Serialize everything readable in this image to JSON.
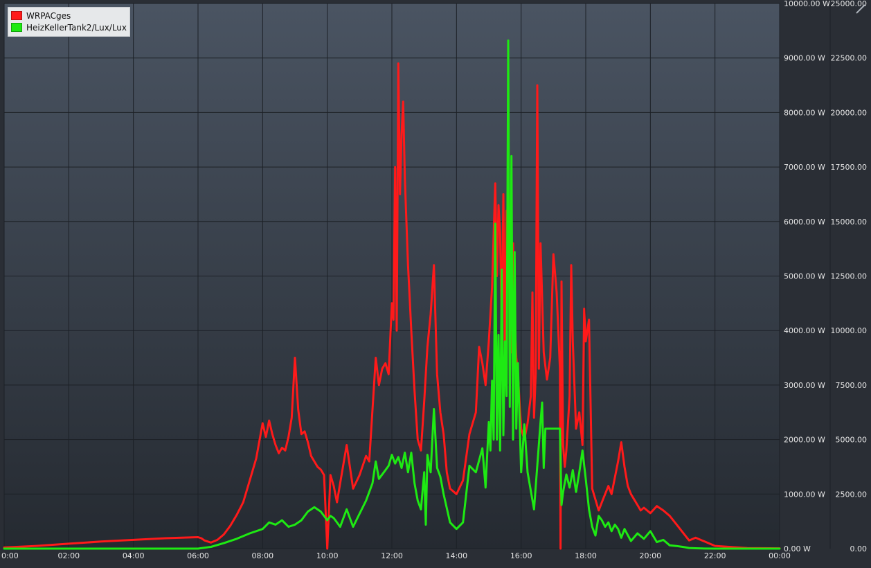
{
  "chart_data": {
    "type": "line",
    "x_axis": {
      "tick_labels": [
        "0:00",
        "02:00",
        "04:00",
        "06:00",
        "08:00",
        "10:00",
        "12:00",
        "14:00",
        "16:00",
        "18:00",
        "20:00",
        "22:00",
        "00:00"
      ],
      "range_hours": [
        0,
        24
      ]
    },
    "y_axis_left": {
      "unit": "W",
      "range": [
        0,
        10000
      ],
      "tick_labels": [
        "0.00 W",
        "1000.00 W",
        "2000.00 W",
        "3000.00 W",
        "4000.00 W",
        "5000.00 W",
        "6000.00 W",
        "7000.00 W",
        "8000.00 W",
        "9000.00 W",
        "10000.00 W"
      ]
    },
    "y_axis_right": {
      "range": [
        0,
        25000
      ],
      "tick_labels": [
        "0.00",
        "2500.00",
        "5000.00",
        "7500.00",
        "10000.00",
        "12500.00",
        "15000.00",
        "17500.00",
        "20000.00",
        "22500.00",
        "25000.00"
      ]
    },
    "grid": true,
    "legend_position": "top-left",
    "series": [
      {
        "name": "WRPACges",
        "color": "#ff1a1a",
        "axis": "left",
        "x": [
          0,
          1,
          2,
          3,
          4,
          5,
          6,
          6.1,
          6.2,
          6.4,
          6.6,
          6.8,
          7.0,
          7.2,
          7.4,
          7.6,
          7.8,
          8.0,
          8.1,
          8.2,
          8.3,
          8.4,
          8.5,
          8.6,
          8.7,
          8.8,
          8.9,
          9.0,
          9.1,
          9.2,
          9.3,
          9.4,
          9.5,
          9.6,
          9.7,
          9.8,
          9.9,
          10.0,
          10.1,
          10.2,
          10.25,
          10.3,
          10.4,
          10.6,
          10.8,
          11.0,
          11.2,
          11.3,
          11.5,
          11.6,
          11.7,
          11.8,
          11.9,
          12.0,
          12.05,
          12.1,
          12.15,
          12.2,
          12.25,
          12.3,
          12.35,
          12.4,
          12.45,
          12.5,
          12.55,
          12.6,
          12.7,
          12.8,
          12.9,
          13.0,
          13.1,
          13.2,
          13.3,
          13.4,
          13.5,
          13.6,
          13.7,
          13.8,
          13.9,
          14.0,
          14.2,
          14.4,
          14.6,
          14.7,
          14.8,
          14.9,
          15.0,
          15.1,
          15.2,
          15.25,
          15.3,
          15.35,
          15.4,
          15.45,
          15.5,
          15.55,
          15.6,
          15.65,
          15.7,
          15.75,
          15.8,
          15.85,
          15.9,
          16.0,
          16.1,
          16.2,
          16.3,
          16.35,
          16.4,
          16.45,
          16.5,
          16.55,
          16.6,
          16.7,
          16.8,
          16.9,
          17.0,
          17.1,
          17.2,
          17.22,
          17.25,
          17.3,
          17.35,
          17.4,
          17.5,
          17.55,
          17.6,
          17.7,
          17.8,
          17.85,
          17.9,
          17.95,
          18.0,
          18.1,
          18.2,
          18.3,
          18.4,
          18.5,
          18.6,
          18.7,
          18.8,
          18.9,
          19.0,
          19.1,
          19.2,
          19.3,
          19.4,
          19.5,
          19.6,
          19.7,
          19.8,
          20.0,
          20.2,
          20.4,
          20.6,
          20.8,
          21.0,
          21.2,
          21.4,
          21.6,
          22.0,
          23.0,
          24.0
        ],
        "y": [
          20,
          50,
          90,
          130,
          160,
          190,
          210,
          190,
          150,
          110,
          160,
          260,
          420,
          620,
          850,
          1250,
          1650,
          2300,
          2050,
          2350,
          2100,
          1900,
          1750,
          1850,
          1800,
          2050,
          2400,
          3500,
          2550,
          2100,
          2150,
          1950,
          1700,
          1600,
          1500,
          1450,
          1350,
          -200,
          1350,
          1150,
          1000,
          850,
          1200,
          1900,
          1100,
          1350,
          1700,
          1600,
          3500,
          3000,
          3300,
          3400,
          3200,
          4500,
          4200,
          7000,
          4000,
          8900,
          6500,
          7600,
          8200,
          6800,
          6000,
          5200,
          4600,
          4000,
          2900,
          2000,
          1800,
          2700,
          3700,
          4300,
          5200,
          3200,
          2500,
          2100,
          1400,
          1100,
          1050,
          1000,
          1250,
          2100,
          2500,
          3700,
          3400,
          3000,
          3800,
          4800,
          6700,
          5000,
          6300,
          5800,
          4000,
          6500,
          3500,
          6200,
          4900,
          5800,
          3600,
          5600,
          4200,
          3500,
          3200,
          2200,
          2000,
          2300,
          2800,
          4700,
          2400,
          3200,
          8500,
          3300,
          5600,
          3600,
          3100,
          3500,
          5400,
          4700,
          3300,
          -100,
          4900,
          1900,
          1500,
          1800,
          2800,
          5200,
          3800,
          2200,
          2500,
          2200,
          1900,
          4400,
          3800,
          4200,
          1100,
          900,
          700,
          850,
          1000,
          1150,
          1000,
          1300,
          1600,
          1950,
          1500,
          1150,
          1000,
          900,
          800,
          700,
          750,
          650,
          780,
          700,
          600,
          450,
          300,
          150,
          200,
          150,
          50,
          10,
          5
        ]
      },
      {
        "name": "HeizKellerTank2/Lux/Lux",
        "color": "#1eea13",
        "axis": "right",
        "x": [
          0,
          2,
          4,
          6,
          6.4,
          6.8,
          7.2,
          7.6,
          8.0,
          8.2,
          8.4,
          8.6,
          8.8,
          9.0,
          9.2,
          9.4,
          9.6,
          9.8,
          10.0,
          10.1,
          10.2,
          10.4,
          10.6,
          10.8,
          11.0,
          11.2,
          11.4,
          11.5,
          11.6,
          11.8,
          11.9,
          12.0,
          12.1,
          12.2,
          12.3,
          12.4,
          12.5,
          12.6,
          12.7,
          12.8,
          12.9,
          13.0,
          13.05,
          13.1,
          13.2,
          13.3,
          13.4,
          13.5,
          13.6,
          13.8,
          14.0,
          14.2,
          14.4,
          14.6,
          14.8,
          14.9,
          15.0,
          15.05,
          15.1,
          15.15,
          15.2,
          15.25,
          15.3,
          15.35,
          15.4,
          15.45,
          15.5,
          15.55,
          15.6,
          15.65,
          15.7,
          15.75,
          15.8,
          15.85,
          15.9,
          16.0,
          16.1,
          16.2,
          16.4,
          16.6,
          16.65,
          16.7,
          16.75,
          17.2,
          17.25,
          17.3,
          17.4,
          17.5,
          17.6,
          17.7,
          17.8,
          17.9,
          18.0,
          18.1,
          18.2,
          18.3,
          18.4,
          18.5,
          18.6,
          18.7,
          18.8,
          18.9,
          19.0,
          19.1,
          19.2,
          19.4,
          19.6,
          19.8,
          20.0,
          20.2,
          20.4,
          20.6,
          20.8,
          21.0,
          21.2,
          21.4,
          21.6,
          22.0,
          24.0
        ],
        "y": [
          0,
          0,
          0,
          0,
          80,
          250,
          450,
          700,
          900,
          1200,
          1100,
          1300,
          1000,
          1100,
          1300,
          1700,
          1900,
          1700,
          1300,
          1500,
          1400,
          1000,
          1800,
          1000,
          1600,
          2200,
          3000,
          4000,
          3200,
          3600,
          3800,
          4300,
          3900,
          4200,
          3700,
          4400,
          3500,
          4400,
          3000,
          2200,
          1800,
          3500,
          1100,
          4300,
          3500,
          6400,
          3700,
          3300,
          2500,
          1200,
          900,
          1200,
          3800,
          3500,
          4600,
          2800,
          5800,
          4500,
          7700,
          5000,
          14900,
          5000,
          9800,
          4500,
          12800,
          5200,
          9500,
          7000,
          23300,
          6500,
          18000,
          5000,
          13600,
          5500,
          8500,
          3500,
          5700,
          3500,
          1800,
          5800,
          6700,
          3700,
          5500,
          5500,
          2000,
          2600,
          3400,
          2800,
          3600,
          2600,
          3500,
          4500,
          3200,
          1800,
          1000,
          600,
          1500,
          1300,
          1000,
          1200,
          800,
          1100,
          900,
          500,
          900,
          350,
          700,
          450,
          800,
          300,
          400,
          150,
          120,
          80,
          30,
          15,
          5,
          0,
          0
        ]
      }
    ]
  },
  "legend": {
    "items": [
      {
        "label": "WRPACges",
        "color": "#ff1a1a"
      },
      {
        "label": "HeizKellerTank2/Lux/Lux",
        "color": "#1eea13"
      }
    ]
  }
}
